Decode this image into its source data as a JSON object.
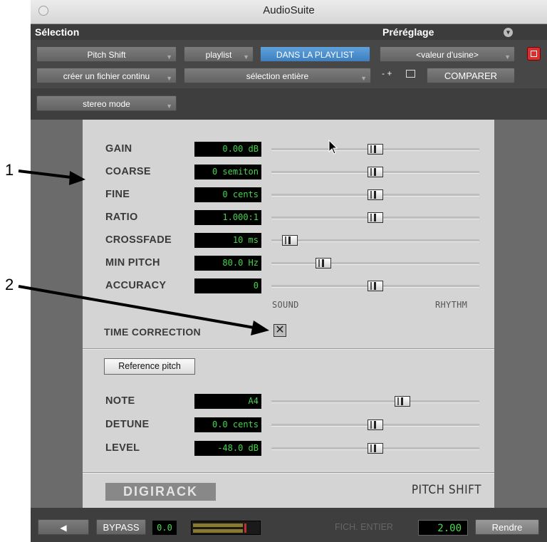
{
  "annotations": {
    "marker1": "1",
    "marker2": "2"
  },
  "window": {
    "title": "AudioSuite"
  },
  "header": {
    "selection_label": "Sélection",
    "preset_label": "Préréglage"
  },
  "controls": {
    "plugin": "Pitch Shift",
    "playlist": "playlist",
    "dans_playlist": "DANS LA PLAYLIST",
    "preset_value": "<valeur d'usine>",
    "file_mode": "créer un fichier continu",
    "selection_mode": "sélection entière",
    "preset_ops": "- +",
    "compare": "COMPARER",
    "stereo_mode": "stereo mode"
  },
  "params": [
    {
      "label": "GAIN",
      "value": "0.00 dB",
      "position": 0.5
    },
    {
      "label": "COARSE",
      "value": "0 semiton",
      "position": 0.5
    },
    {
      "label": "FINE",
      "value": "0 cents",
      "position": 0.5
    },
    {
      "label": "RATIO",
      "value": "1.000:1",
      "position": 0.5
    },
    {
      "label": "CROSSFADE",
      "value": "10 ms",
      "position": 0.09
    },
    {
      "label": "MIN PITCH",
      "value": "80.0 Hz",
      "position": 0.25
    },
    {
      "label": "ACCURACY",
      "value": "0",
      "position": 0.5
    }
  ],
  "accuracy_scale": {
    "left": "SOUND",
    "right": "RHYTHM"
  },
  "time_correction": {
    "label": "TIME CORRECTION",
    "checked": true
  },
  "reference_pitch": {
    "button": "Reference pitch",
    "params": [
      {
        "label": "NOTE",
        "value": "A4",
        "position": 0.63
      },
      {
        "label": "DETUNE",
        "value": "0.0 cents",
        "position": 0.5
      },
      {
        "label": "LEVEL",
        "value": "-48.0 dB",
        "position": 0.5
      }
    ]
  },
  "branding": {
    "digirack": "DIGIRACK",
    "plugin_name": "PITCH SHIFT"
  },
  "bottom": {
    "bypass": "BYPASS",
    "level": "0.0",
    "fich_entier": "FICH. ENTIER",
    "handle": "2.00",
    "render": "Rendre"
  }
}
